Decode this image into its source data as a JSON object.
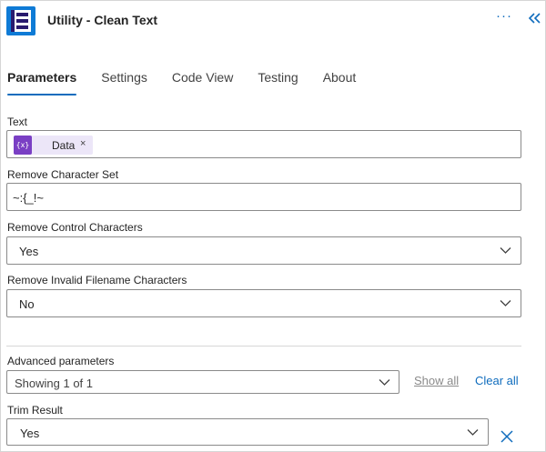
{
  "header": {
    "title": "Utility - Clean Text",
    "more_glyph": "···",
    "logo_icon": "connector-logo-icon",
    "collapse_icon": "double-chevron-left-icon"
  },
  "tabs": [
    {
      "label": "Parameters",
      "active": true
    },
    {
      "label": "Settings",
      "active": false
    },
    {
      "label": "Code View",
      "active": false
    },
    {
      "label": "Testing",
      "active": false
    },
    {
      "label": "About",
      "active": false
    }
  ],
  "fields": {
    "text": {
      "label": "Text",
      "token": {
        "icon_text": "{x}",
        "label": "Data",
        "remove_glyph": "×"
      }
    },
    "remove_character_set": {
      "label": "Remove Character Set",
      "value": "~:{_!~"
    },
    "remove_control_characters": {
      "label": "Remove Control Characters",
      "value": "Yes"
    },
    "remove_invalid_filename_characters": {
      "label": "Remove Invalid Filename Characters",
      "value": "No"
    }
  },
  "advanced": {
    "label": "Advanced parameters",
    "select_value": "Showing 1 of 1",
    "show_all": "Show all",
    "clear_all": "Clear all"
  },
  "trim_result": {
    "label": "Trim Result",
    "value": "Yes",
    "remove_icon": "close-icon"
  },
  "colors": {
    "accent": "#0f6cbd",
    "logo_bg": "#0f7bd6",
    "token_icon": "#7a3fc4",
    "token_bg": "#ece6f8"
  }
}
